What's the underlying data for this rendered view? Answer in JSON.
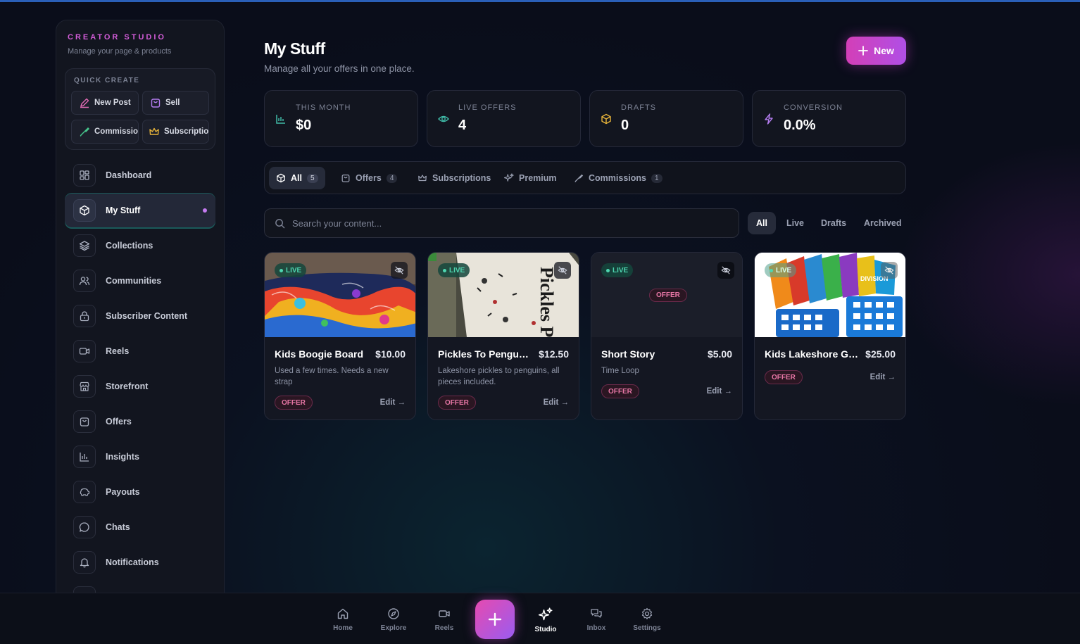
{
  "sidebar": {
    "brand": "CREATOR STUDIO",
    "brand_sub": "Manage your page & products",
    "quick_create": {
      "title": "QUICK CREATE",
      "buttons": [
        "New Post",
        "Sell",
        "Commission",
        "Subscription"
      ]
    },
    "items": [
      {
        "label": "Dashboard",
        "icon": "grid-icon"
      },
      {
        "label": "My Stuff",
        "icon": "cube-icon",
        "active": true
      },
      {
        "label": "Collections",
        "icon": "layers-icon"
      },
      {
        "label": "Communities",
        "icon": "users-icon"
      },
      {
        "label": "Subscriber Content",
        "icon": "lock-icon"
      },
      {
        "label": "Reels",
        "icon": "video-icon"
      },
      {
        "label": "Storefront",
        "icon": "store-icon"
      },
      {
        "label": "Offers",
        "icon": "bag-icon"
      },
      {
        "label": "Insights",
        "icon": "bar-chart-icon"
      },
      {
        "label": "Payouts",
        "icon": "piggy-bank-icon"
      },
      {
        "label": "Chats",
        "icon": "chat-icon"
      },
      {
        "label": "Notifications",
        "icon": "bell-icon"
      }
    ]
  },
  "header": {
    "title": "My Stuff",
    "subtitle": "Manage all your offers in one place.",
    "new_button": "New"
  },
  "stats": [
    {
      "label": "THIS MONTH",
      "value": "$0",
      "icon": "bar-chart-icon"
    },
    {
      "label": "LIVE OFFERS",
      "value": "4",
      "icon": "eye-icon"
    },
    {
      "label": "DRAFTS",
      "value": "0",
      "icon": "box-icon"
    },
    {
      "label": "CONVERSION",
      "value": "0.0%",
      "icon": "bolt-icon"
    }
  ],
  "tabs": [
    {
      "label": "All",
      "count": "5",
      "active": true
    },
    {
      "label": "Offers",
      "count": "4"
    },
    {
      "label": "Subscriptions",
      "count": ""
    },
    {
      "label": "Premium",
      "count": ""
    },
    {
      "label": "Commissions",
      "count": "1"
    }
  ],
  "search": {
    "placeholder": "Search your content..."
  },
  "filters": [
    "All",
    "Live",
    "Drafts",
    "Archived"
  ],
  "cards": [
    {
      "title": "Kids Boogie Board",
      "price": "$10.00",
      "desc": "Used a few times. Needs a new strap",
      "status": "LIVE",
      "type": "OFFER",
      "edit": "Edit →"
    },
    {
      "title": "Pickles To Penguins...",
      "price": "$12.50",
      "desc": "Lakeshore pickles to penguins, all pieces included.",
      "status": "LIVE",
      "type": "OFFER",
      "edit": "Edit →",
      "thumb_text": "Pickles Penguins"
    },
    {
      "title": "Short Story",
      "price": "$5.00",
      "desc": "Time Loop",
      "status": "LIVE",
      "type": "OFFER",
      "edit": "Edit →"
    },
    {
      "title": "Kids Lakeshore Game",
      "price": "$25.00",
      "desc": "",
      "status": "LIVE",
      "type": "OFFER",
      "edit": "Edit →",
      "thumb_text": "DIVISION"
    }
  ],
  "bottom_nav": [
    {
      "label": "Home",
      "icon": "home-icon"
    },
    {
      "label": "Explore",
      "icon": "compass-icon"
    },
    {
      "label": "Reels",
      "icon": "video-icon"
    },
    {
      "label": "Studio",
      "icon": "sparkles-icon",
      "active": true
    },
    {
      "label": "Inbox",
      "icon": "inbox-icon"
    },
    {
      "label": "Settings",
      "icon": "gear-icon"
    }
  ],
  "colors": {
    "accent": "#c94fd6",
    "live": "#4ed6b0",
    "offer": "#e877a6",
    "background": "#0a0d1a"
  }
}
